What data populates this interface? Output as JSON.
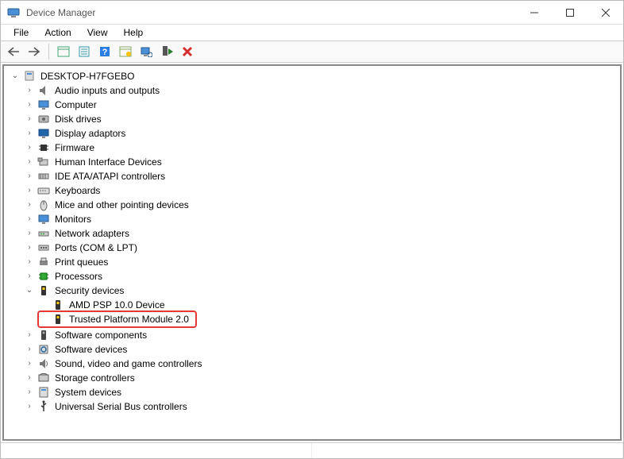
{
  "window": {
    "title": "Device Manager"
  },
  "menus": [
    "File",
    "Action",
    "View",
    "Help"
  ],
  "toolbar_icons": [
    "back",
    "forward",
    "|",
    "show-hidden",
    "properties",
    "help",
    "update",
    "monitor",
    "add",
    "delete"
  ],
  "root": {
    "label": "DESKTOP-H7FGEBO",
    "icon": "computer"
  },
  "categories": [
    {
      "label": "Audio inputs and outputs",
      "icon": "audio",
      "expanded": false
    },
    {
      "label": "Computer",
      "icon": "computer-monitor",
      "expanded": false
    },
    {
      "label": "Disk drives",
      "icon": "disk",
      "expanded": false
    },
    {
      "label": "Display adaptors",
      "icon": "display",
      "expanded": false
    },
    {
      "label": "Firmware",
      "icon": "chip",
      "expanded": false
    },
    {
      "label": "Human Interface Devices",
      "icon": "hid",
      "expanded": false
    },
    {
      "label": "IDE ATA/ATAPI controllers",
      "icon": "ide",
      "expanded": false
    },
    {
      "label": "Keyboards",
      "icon": "keyboard",
      "expanded": false
    },
    {
      "label": "Mice and other pointing devices",
      "icon": "mouse",
      "expanded": false
    },
    {
      "label": "Monitors",
      "icon": "monitor",
      "expanded": false
    },
    {
      "label": "Network adapters",
      "icon": "network",
      "expanded": false
    },
    {
      "label": "Ports (COM & LPT)",
      "icon": "port",
      "expanded": false
    },
    {
      "label": "Print queues",
      "icon": "printer",
      "expanded": false
    },
    {
      "label": "Processors",
      "icon": "cpu",
      "expanded": false
    },
    {
      "label": "Security devices",
      "icon": "security-chip",
      "expanded": true,
      "children": [
        {
          "label": "AMD PSP 10.0 Device",
          "icon": "security-chip",
          "highlighted": false
        },
        {
          "label": "Trusted Platform Module 2.0",
          "icon": "security-chip",
          "highlighted": true
        }
      ]
    },
    {
      "label": "Software components",
      "icon": "component",
      "expanded": false
    },
    {
      "label": "Software devices",
      "icon": "sw-device",
      "expanded": false
    },
    {
      "label": "Sound, video and game controllers",
      "icon": "sound",
      "expanded": false
    },
    {
      "label": "Storage controllers",
      "icon": "storage",
      "expanded": false
    },
    {
      "label": "System devices",
      "icon": "system",
      "expanded": false
    },
    {
      "label": "Universal Serial Bus controllers",
      "icon": "usb",
      "expanded": false
    }
  ]
}
